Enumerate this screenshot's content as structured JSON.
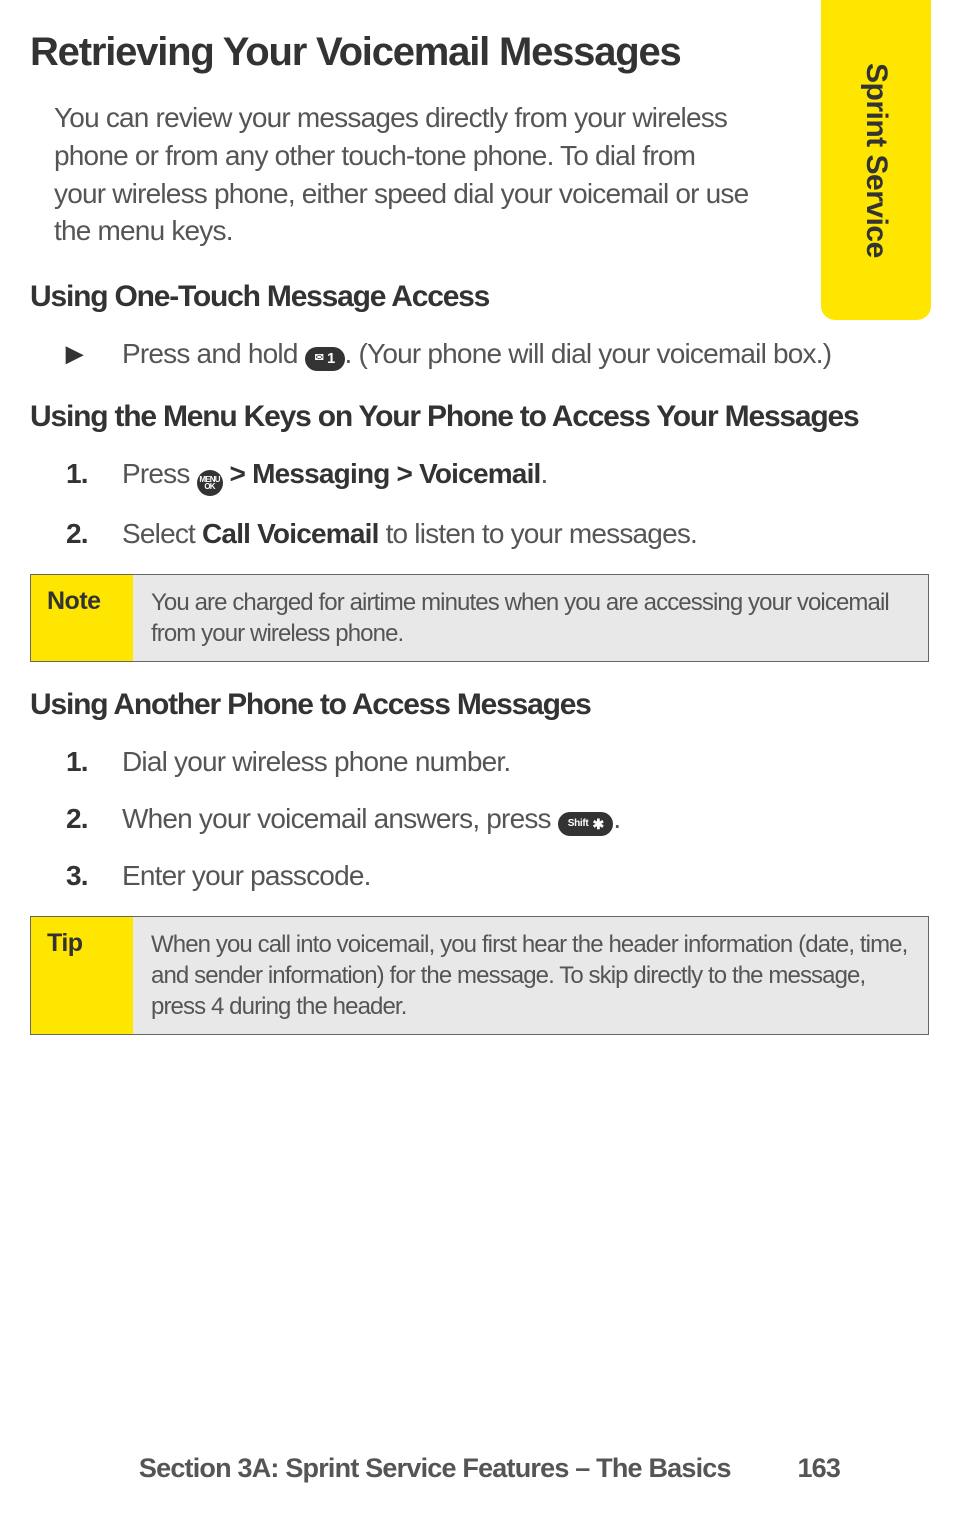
{
  "tab": {
    "label": "Sprint Service"
  },
  "title": "Retrieving Your Voicemail Messages",
  "intro": "You can review your messages directly from your wireless phone or from any other touch-tone phone. To dial from your wireless phone, either speed dial your voicemail or use the menu keys.",
  "sec1": {
    "heading": "Using One-Touch Message Access",
    "bullet_pre": "Press and hold ",
    "bullet_post": ". (Your phone will dial your voicemail box.)",
    "key1_a": "✉",
    "key1_b": "1"
  },
  "sec2": {
    "heading": "Using the Menu Keys on Your Phone to Access Your Messages",
    "step1_num": "1.",
    "step1_a": "Press ",
    "step1_key_top": "MENU",
    "step1_key_bot": "OK",
    "step1_b": " > Messaging > Voicemail",
    "step1_c": ".",
    "step2_num": "2.",
    "step2_a": "Select ",
    "step2_b": "Call Voicemail",
    "step2_c": " to listen to your messages."
  },
  "note": {
    "label": "Note",
    "body": "You are charged for airtime minutes when you are accessing your voicemail from your wireless phone."
  },
  "sec3": {
    "heading": "Using Another Phone to Access Messages",
    "step1_num": "1.",
    "step1": "Dial your wireless phone number.",
    "step2_num": "2.",
    "step2_a": "When your voicemail answers, press ",
    "step2_key_a": "Shift",
    "step2_key_b": "✱",
    "step2_b": ".",
    "step3_num": "3.",
    "step3": "Enter your passcode."
  },
  "tip": {
    "label": "Tip",
    "body": "When you call into voicemail, you first hear the header information (date, time, and sender information) for the message. To skip directly to the message, press 4 during the header."
  },
  "footer": {
    "section": "Section 3A: Sprint Service Features – The Basics",
    "page": "163"
  }
}
